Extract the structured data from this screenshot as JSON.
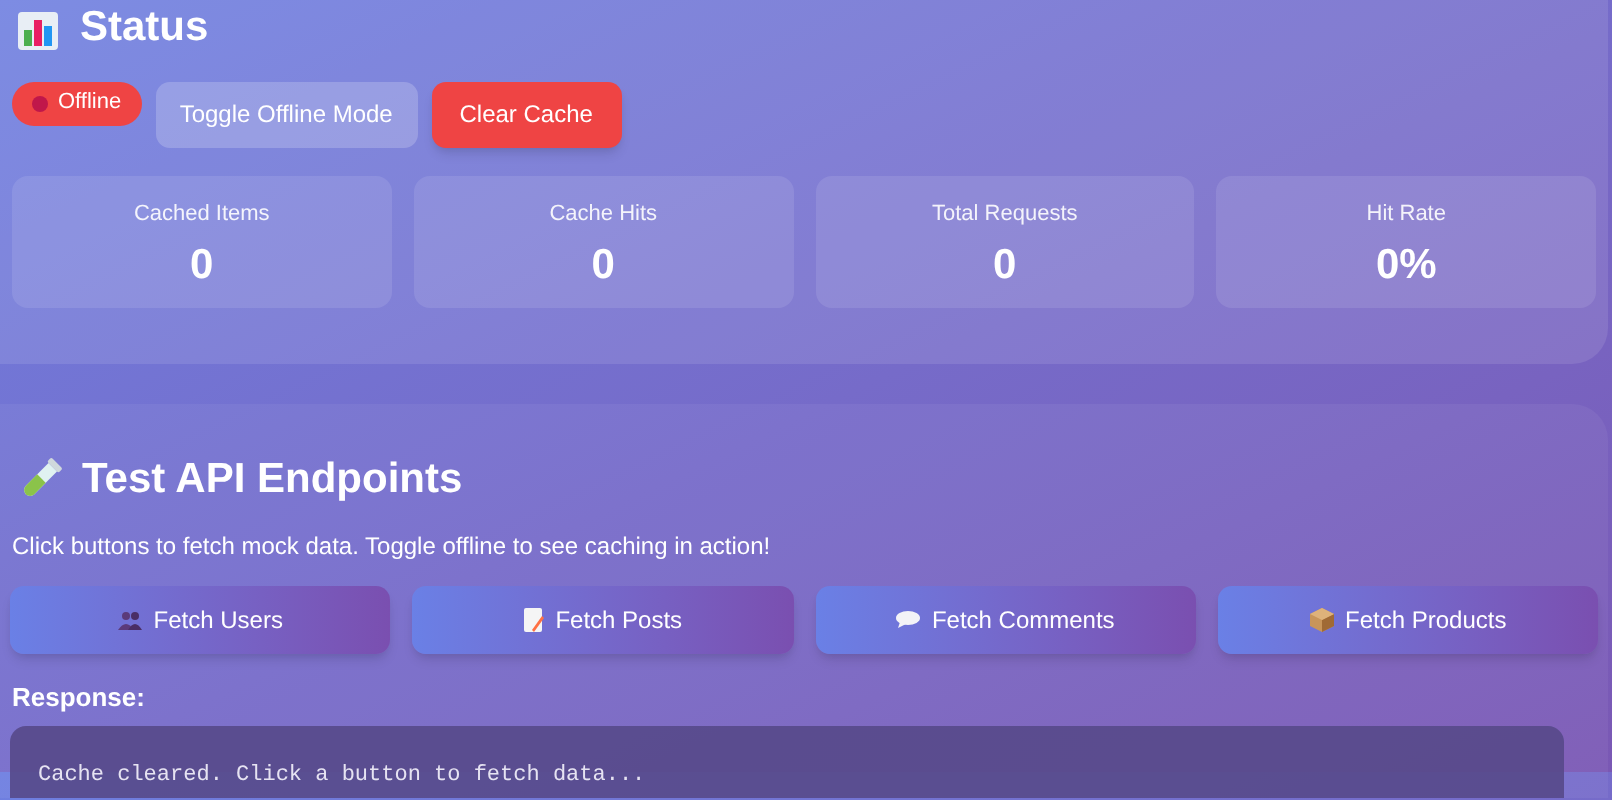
{
  "status": {
    "title": "Status",
    "badge": {
      "label": "Offline",
      "online": false
    },
    "buttons": [
      {
        "label": "Toggle Offline Mode",
        "kind": "secondary"
      },
      {
        "label": "Clear Cache",
        "kind": "danger"
      }
    ],
    "stats": [
      {
        "label": "Cached Items",
        "value": "0"
      },
      {
        "label": "Cache Hits",
        "value": "0"
      },
      {
        "label": "Total Requests",
        "value": "0"
      },
      {
        "label": "Hit Rate",
        "value": "0%"
      }
    ]
  },
  "endpoints": {
    "title": "Test API Endpoints",
    "hint": "Click buttons to fetch mock data. Toggle offline to see caching in action!",
    "buttons": [
      {
        "label": "Fetch Users"
      },
      {
        "label": "Fetch Posts"
      },
      {
        "label": "Fetch Comments"
      },
      {
        "label": "Fetch Products"
      }
    ],
    "response_label": "Response:",
    "response": "Cache cleared. Click a button to fetch data..."
  }
}
